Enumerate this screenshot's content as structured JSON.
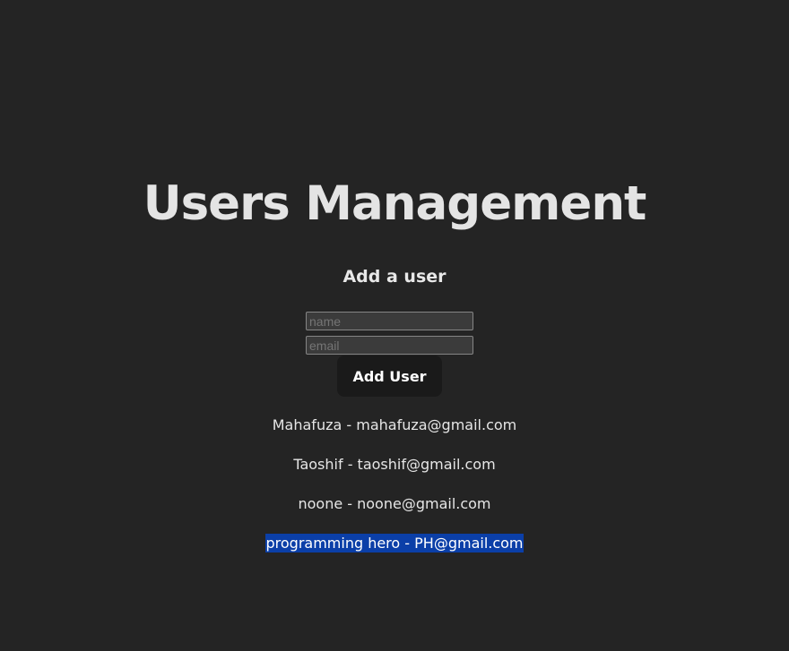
{
  "header": {
    "title": "Users Management"
  },
  "form": {
    "heading": "Add a user",
    "name_placeholder": "name",
    "email_placeholder": "email",
    "submit_label": "Add User"
  },
  "users": [
    {
      "text": "Mahafuza - mahafuza@gmail.com"
    },
    {
      "text": "Taoshif - taoshif@gmail.com"
    },
    {
      "text": "noone - noone@gmail.com"
    },
    {
      "text": "programming hero - PH@gmail.com",
      "selected": true
    }
  ],
  "colors": {
    "background": "#242424",
    "selection": "#0b3fa8",
    "button": "#1a1a1a"
  }
}
